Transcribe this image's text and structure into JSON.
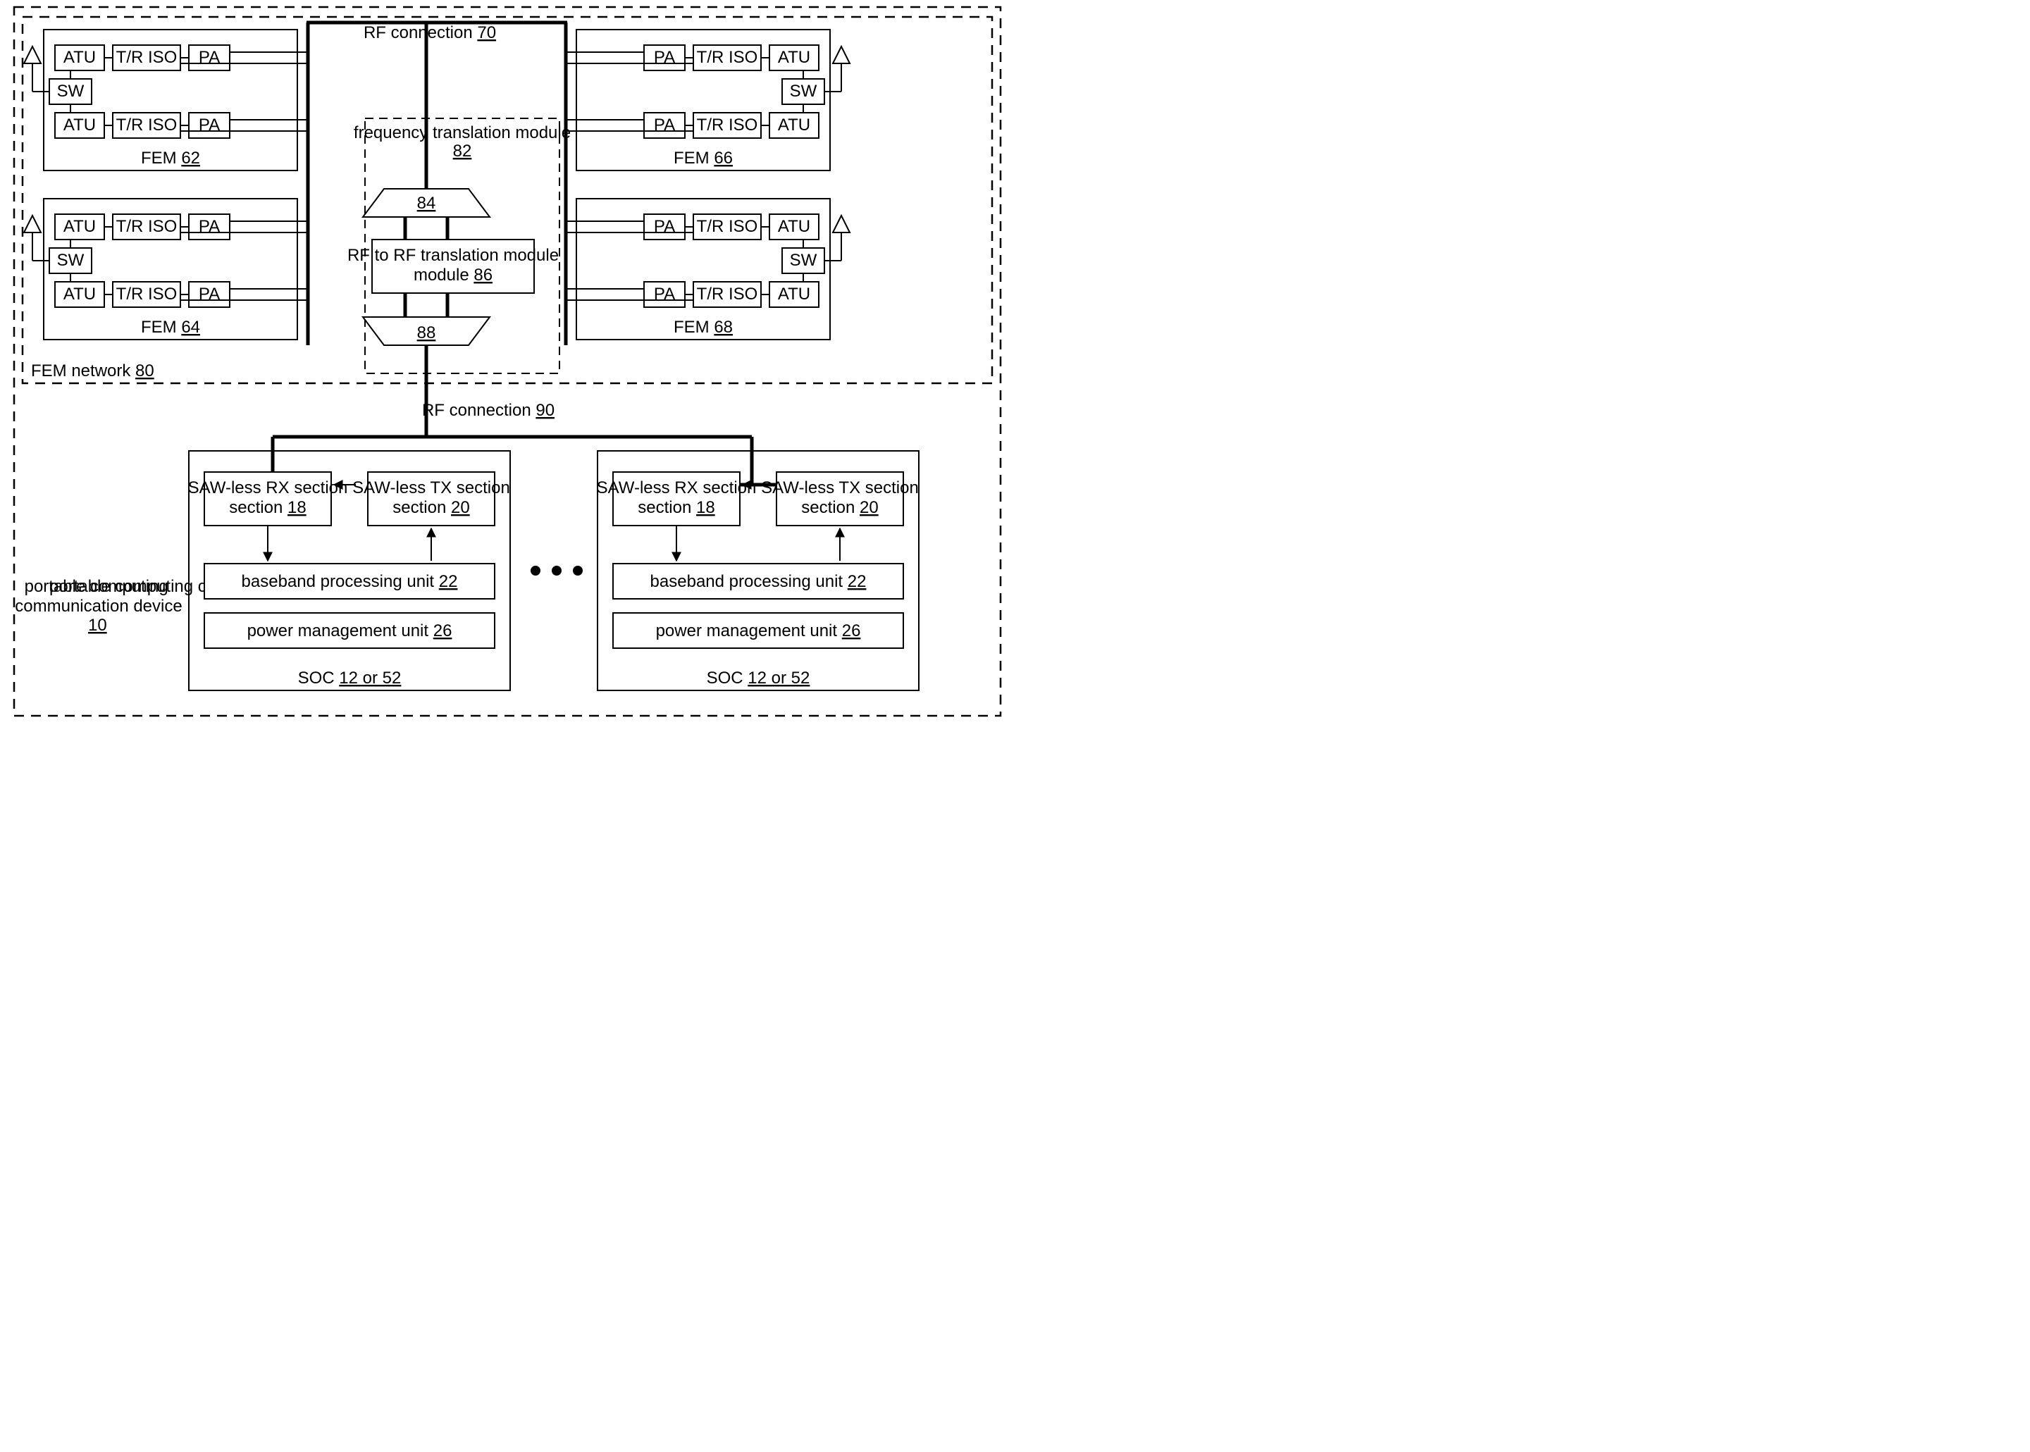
{
  "global": {
    "device_label": "portable computing communication device",
    "device_ref": "10",
    "fem_network_label": "FEM network",
    "fem_network_ref": "80",
    "rf_top_label": "RF connection",
    "rf_top_ref": "70",
    "rf_bot_label": "RF connection",
    "rf_bot_ref": "90"
  },
  "ftm": {
    "title": "frequency translation module",
    "ref": "82",
    "top_mux_ref": "84",
    "bot_mux_ref": "88",
    "core_label": "RF to RF translation module",
    "core_ref": "86"
  },
  "fem": {
    "atu": "ATU",
    "triso": "T/R ISO",
    "pa": "PA",
    "sw": "SW",
    "title": "FEM",
    "r62": "62",
    "r64": "64",
    "r66": "66",
    "r68": "68"
  },
  "soc": {
    "rx_label": "SAW-less RX section",
    "rx_ref": "18",
    "tx_label": "SAW-less TX section",
    "tx_ref": "20",
    "bb_label": "baseband processing unit",
    "bb_ref": "22",
    "pm_label": "power management unit",
    "pm_ref": "26",
    "title": "SOC",
    "title_ref": "12 or 52"
  }
}
